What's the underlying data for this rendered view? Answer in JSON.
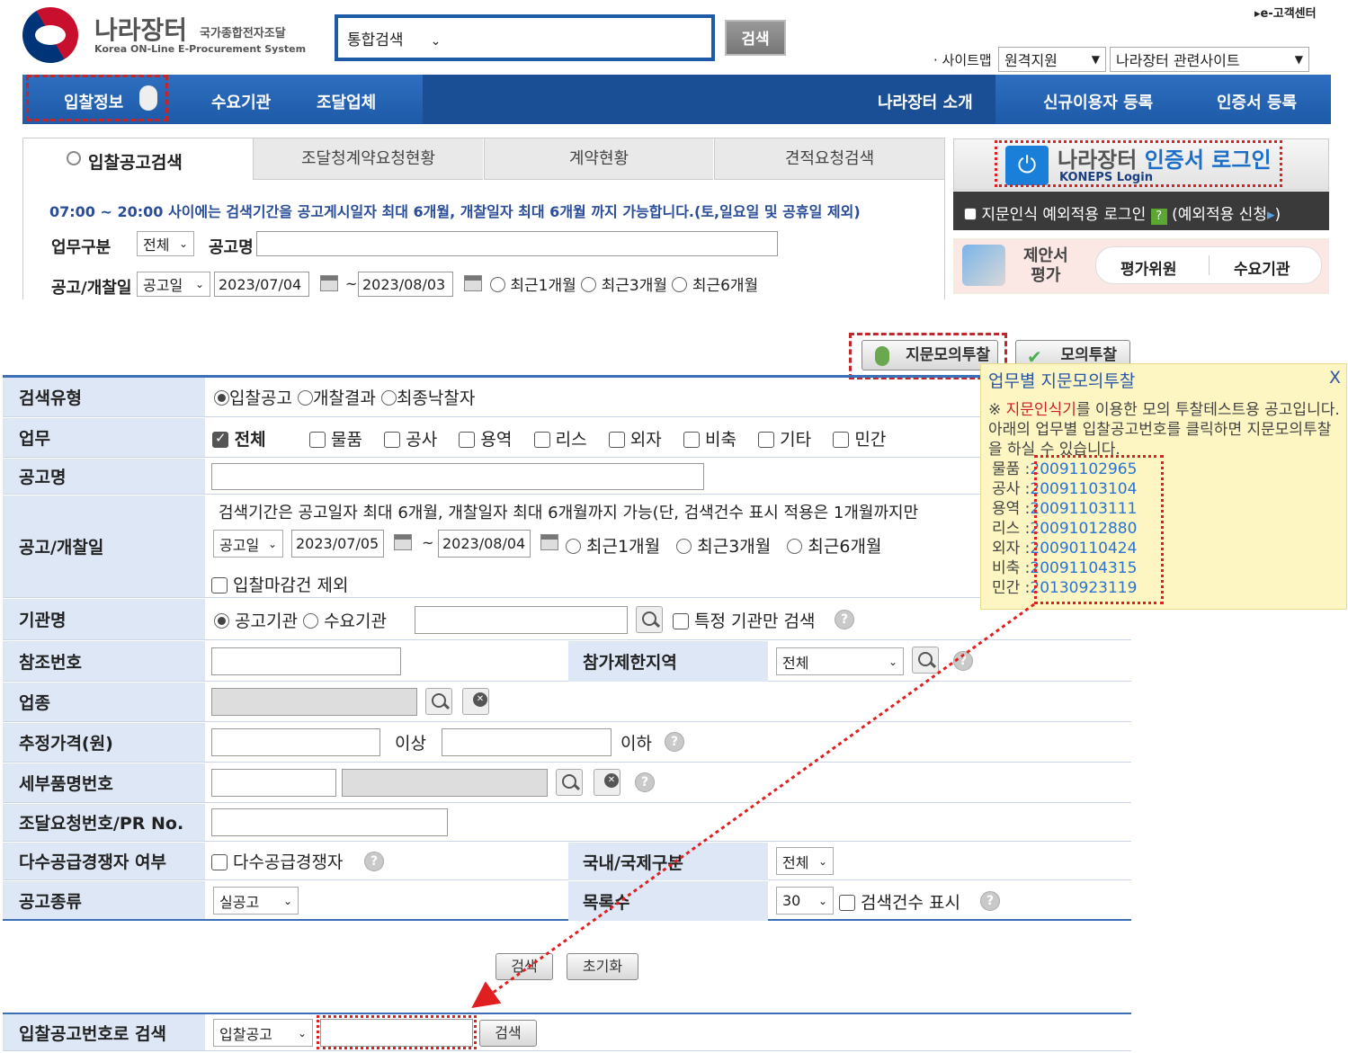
{
  "header": {
    "logo_title": "나라장터",
    "logo_sub": "국가종합전자조달",
    "logo_en": "Korea ON-Line E-Procurement System",
    "search_scope": "통합검색",
    "search_button": "검색",
    "customer_center": "e-고객센터",
    "sitemap": "· 사이트맵",
    "remote_support": "원격지원",
    "related_sites": "나라장터 관련사이트"
  },
  "nav": {
    "bid_info": "입찰정보",
    "demand": "수요기관",
    "supplier": "조달업체",
    "intro": "나라장터 소개",
    "register": "신규이용자 등록",
    "cert": "인증서 등록"
  },
  "upper_tabs": [
    "입찰공고검색",
    "조달청계약요청현황",
    "계약현황",
    "견적요청검색"
  ],
  "upper_form": {
    "notice": "07:00 ~ 20:00 사이에는 검색기간을 공고게시일자 최대 6개월, 개찰일자 최대 6개월 까지 가능합니다.(토,일요일 및 공휴일 제외)",
    "biz_label": "업무구분",
    "biz_value": "전체",
    "title_label": "공고명",
    "date_label": "공고/개찰일",
    "date_type": "공고일",
    "date_from": "2023/07/04",
    "tilde": "~",
    "date_to": "2023/08/03",
    "r1": "최근1개월",
    "r3": "최근3개월",
    "r6": "최근6개월"
  },
  "login": {
    "title_a": "나라장터 ",
    "title_b": "인증서 로그인",
    "sub": "KONEPS Login",
    "fingerprint": "지문인식 예외적용 로그인",
    "apply": "(예외적용 신청",
    "apply_end": ")",
    "proposal_1": "제안서",
    "proposal_2": "평가",
    "evaluator": "평가위원",
    "demand": "수요기관"
  },
  "buttons": {
    "fingerprint_mock": "지문모의투찰",
    "mock": "모의투찰",
    "search": "검색",
    "reset": "초기화"
  },
  "popup": {
    "title": "업무별 지문모의투찰",
    "close": "X",
    "text_prefix": "※ ",
    "text_highlight": "지문인식기",
    "text_rest": "를 이용한 모의 투찰테스트용 공고입니다. 아래의 업무별 입찰공고번호를 클릭하면 지문모의투찰을 하실 수 있습니다.",
    "items": [
      {
        "label": "물품 :",
        "number": "20091102965"
      },
      {
        "label": "공사 :",
        "number": "20091103104"
      },
      {
        "label": "용역 :",
        "number": "20091103111"
      },
      {
        "label": "리스 :",
        "number": "20091012880"
      },
      {
        "label": "외자 :",
        "number": "20090110424"
      },
      {
        "label": "비축 :",
        "number": "20091104315"
      },
      {
        "label": "민간 :",
        "number": "20130923119"
      }
    ]
  },
  "form": {
    "search_type": {
      "label": "검색유형",
      "opts": [
        "입찰공고",
        "개찰결과",
        "최종낙찰자"
      ]
    },
    "biz": {
      "label": "업무",
      "all": "전체",
      "opts": [
        "물품",
        "공사",
        "용역",
        "리스",
        "외자",
        "비축",
        "기타",
        "민간"
      ]
    },
    "title": {
      "label": "공고명"
    },
    "date": {
      "label": "공고/개찰일",
      "notice": "검색기간은 공고일자 최대 6개월, 개찰일자 최대 6개월까지 가능(단, 검색건수 표시 적용은 1개월까지만",
      "type": "공고일",
      "from": "2023/07/05",
      "tilde": "~",
      "to": "2023/08/04",
      "r1": "최근1개월",
      "r3": "최근3개월",
      "r6": "최근6개월",
      "exclude": "입찰마감건 제외"
    },
    "org": {
      "label": "기관명",
      "opt1": "공고기관",
      "opt2": "수요기관",
      "only": "특정 기관만 검색"
    },
    "ref": {
      "label": "참조번호",
      "region_label": "참가제한지역",
      "region_value": "전체"
    },
    "industry": {
      "label": "업종"
    },
    "price": {
      "label": "추정가격(원)",
      "above": "이상",
      "below": "이하"
    },
    "detail": {
      "label": "세부품명번호"
    },
    "pr": {
      "label": "조달요청번호/PR No."
    },
    "multi": {
      "label": "다수공급경쟁자 여부",
      "check": "다수공급경쟁자",
      "intl_label": "국내/국제구분",
      "intl_value": "전체"
    },
    "kind": {
      "label": "공고종류",
      "value": "실공고",
      "list_label": "목록수",
      "list_value": "30",
      "show_count": "검색건수 표시"
    }
  },
  "bottom": {
    "label": "입찰공고번호로 검색",
    "type": "입찰공고",
    "button": "검색"
  }
}
